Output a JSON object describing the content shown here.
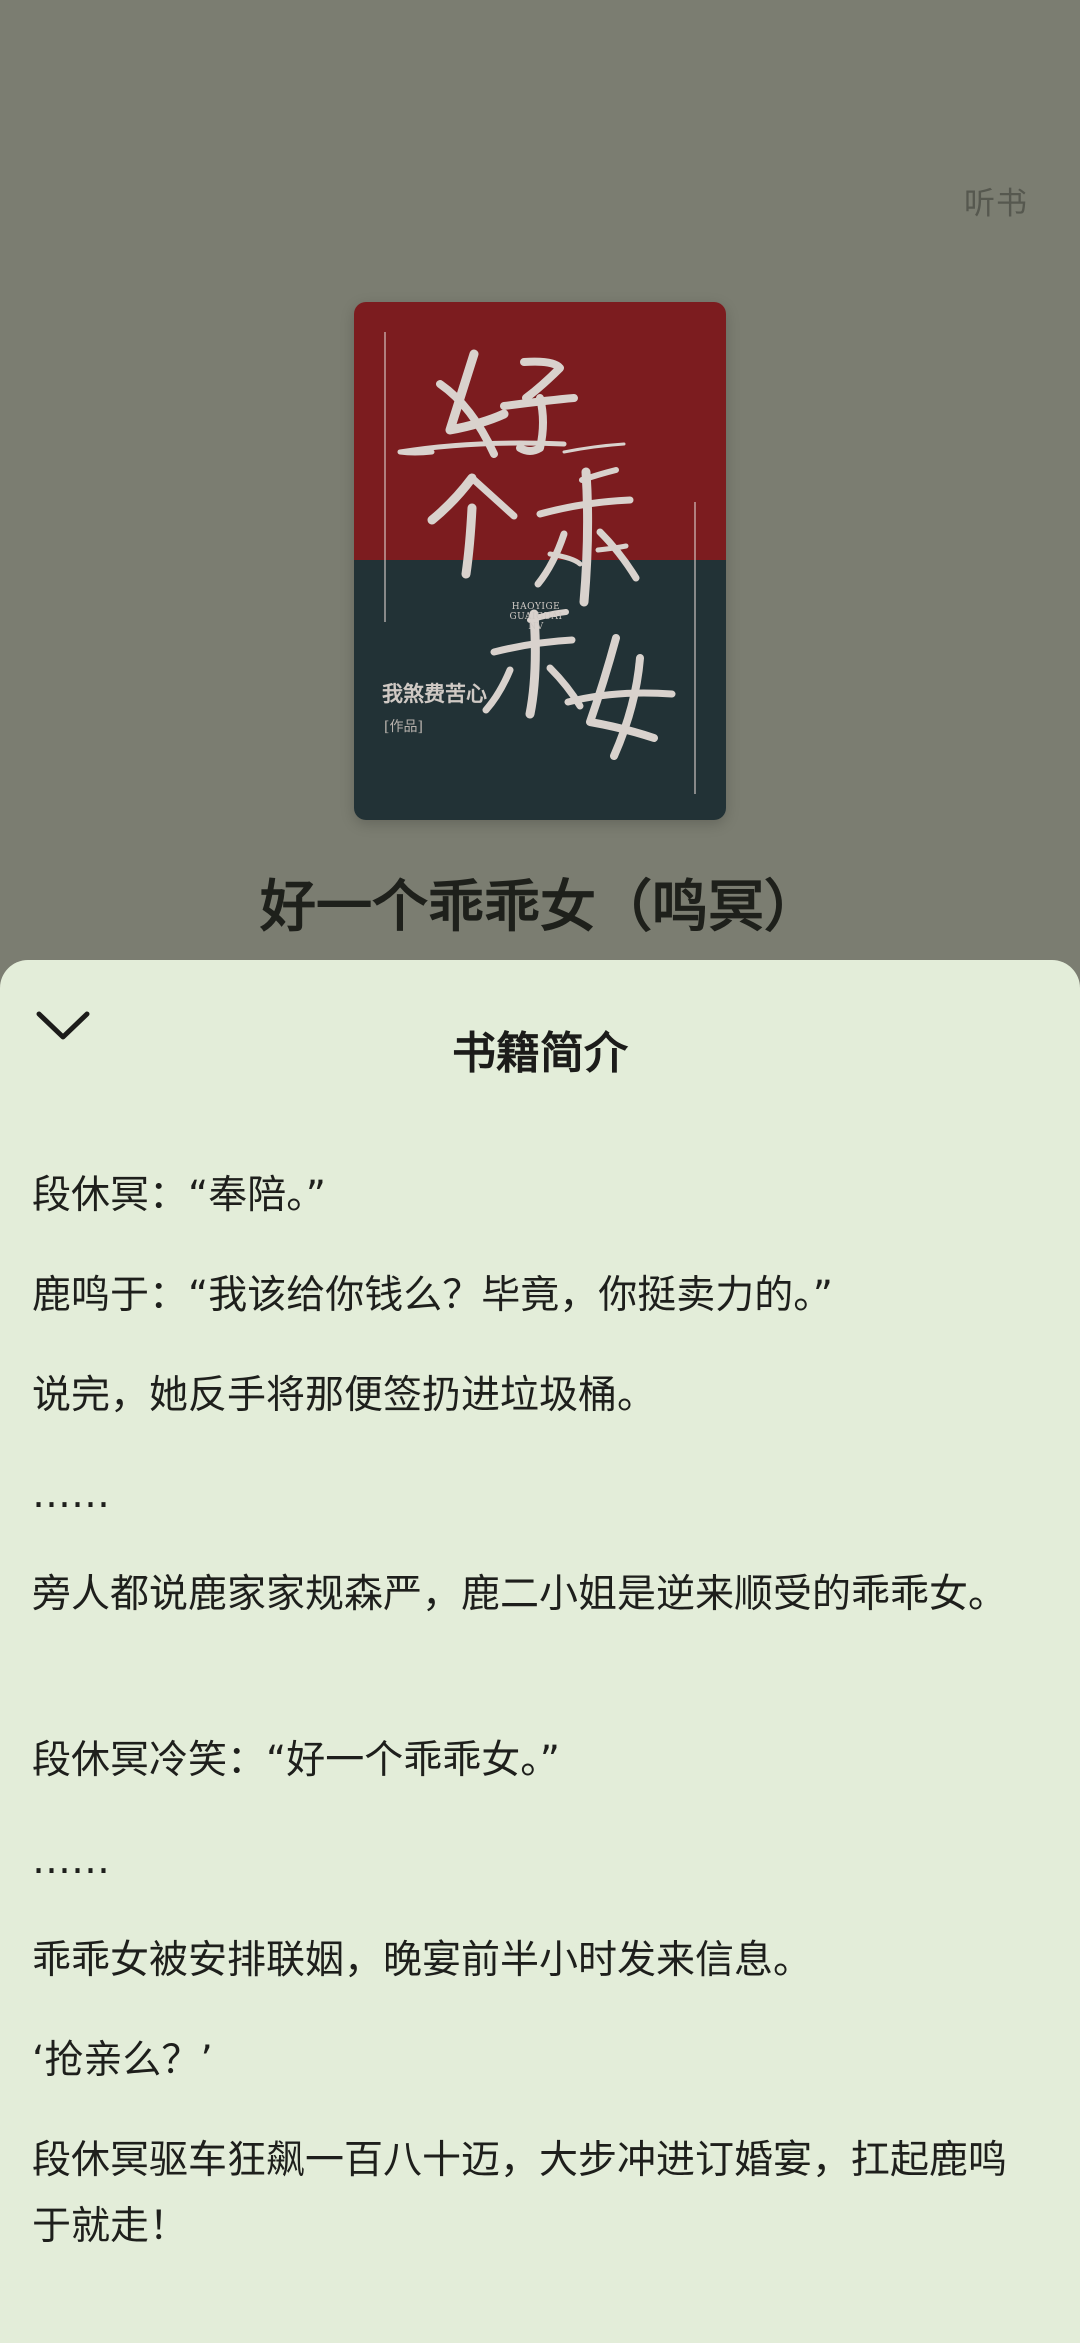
{
  "header": {
    "listen_label": "听书"
  },
  "cover": {
    "author": "我煞费苦心",
    "tag": "[作品]",
    "pinyin": "HAOYIGE GUAIGUAI NV",
    "top_color": "#7c1c1f",
    "bottom_color": "#223236"
  },
  "book": {
    "title": "好一个乖乖女（鸣冥）"
  },
  "sheet": {
    "title": "书籍简介",
    "background": "#e3edd9",
    "paragraphs": [
      "段休冥：“奉陪。”",
      "鹿鸣于：“我该给你钱么？毕竟，你挺卖力的。”",
      "说完，她反手将那便签扔进垃圾桶。",
      "……",
      "旁人都说鹿家家规森严，鹿二小姐是逆来顺受的乖乖女。",
      "段休冥冷笑：“好一个乖乖女。”",
      "……",
      "乖乖女被安排联姻，晚宴前半小时发来信息。",
      "‘抢亲么？’",
      "段休冥驱车狂飙一百八十迈，大步冲进订婚宴，扛起鹿鸣于就走！"
    ]
  }
}
